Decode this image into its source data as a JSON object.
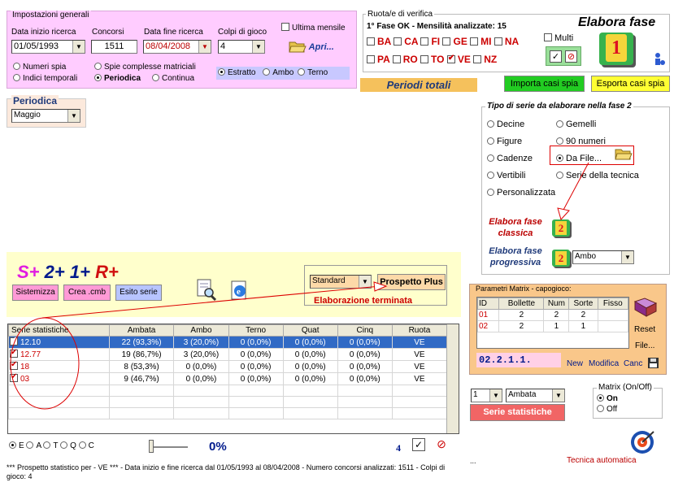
{
  "general": {
    "legend": "Impostazioni generali",
    "date_start_label": "Data inizio ricerca",
    "date_start": "01/05/1993",
    "concorsi_label": "Concorsi",
    "concorsi": "1511",
    "date_end_label": "Data fine ricerca",
    "date_end": "08/04/2008",
    "colpi_label": "Colpi di gioco",
    "colpi": "4",
    "ultima_mensile": "Ultima mensile",
    "apri": "Apri...",
    "opt_numeri_spia": "Numeri spia",
    "opt_spie_complesse": "Spie complesse matriciali",
    "opt_indici_temporali": "Indici temporali",
    "opt_periodica": "Periodica",
    "opt_continua": "Continua",
    "opt_estratto": "Estratto",
    "opt_ambo": "Ambo",
    "opt_terno": "Terno"
  },
  "periodica": {
    "legend": "Periodica",
    "value": "Maggio"
  },
  "ruote": {
    "legend": "Ruota/e di verifica",
    "status": "1° Fase OK - Mensilità analizzate: 15",
    "row1": [
      "BA",
      "CA",
      "FI",
      "GE",
      "MI",
      "NA"
    ],
    "row2": [
      "PA",
      "RO",
      "TO",
      "VE",
      "NZ"
    ],
    "multi": "Multi"
  },
  "elabora_fase": {
    "title": "Elabora fase",
    "number": "1"
  },
  "periodi_totali": "Periodi totali",
  "importa": "Importa casi spia",
  "esporta": "Esporta casi spia",
  "tipo_serie": {
    "legend": "Tipo di serie da elaborare nella fase 2",
    "left": [
      "Decine",
      "Figure",
      "Cadenze",
      "Vertibili",
      "Personalizzata"
    ],
    "right": [
      "Gemelli",
      "90 numeri",
      "Da File...",
      "Serie della tecnica"
    ]
  },
  "elabora_classica": "Elabora fase classica",
  "elabora_progressiva": "Elabora fase progressiva",
  "fase2_number": "2",
  "progressiva_select": "Ambo",
  "splus": {
    "s": "S+",
    "two": "2+",
    "one": "1+",
    "r": "R+"
  },
  "btn_sistemizza": "Sistemizza",
  "btn_crea": "Crea .cmb",
  "btn_esito": "Esito serie",
  "standard_select": "Standard",
  "prospetto_plus": "Prospetto Plus",
  "elaborazione": "Elaborazione terminata",
  "stats_table": {
    "headers": [
      "Serie statistiche",
      "Ambata",
      "Ambo",
      "Terno",
      "Quat",
      "Cinq",
      "Ruota"
    ],
    "rows": [
      [
        "12.10",
        "22 (93,3%)",
        "3 (20,0%)",
        "0 (0,0%)",
        "0 (0,0%)",
        "0 (0,0%)",
        "VE"
      ],
      [
        "12.77",
        "19 (86,7%)",
        "3 (20,0%)",
        "0 (0,0%)",
        "0 (0,0%)",
        "0 (0,0%)",
        "VE"
      ],
      [
        "18",
        "8 (53,3%)",
        "0 (0,0%)",
        "0 (0,0%)",
        "0 (0,0%)",
        "0 (0,0%)",
        "VE"
      ],
      [
        "03",
        "9 (46,7%)",
        "0 (0,0%)",
        "0 (0,0%)",
        "0 (0,0%)",
        "0 (0,0%)",
        "VE"
      ]
    ]
  },
  "bottom_radios": [
    "E",
    "A",
    "T",
    "Q",
    "C"
  ],
  "percent": "0%",
  "count": "4",
  "status_line": "*** Prospetto statistico per  - VE *** - Data inizio e fine ricerca dal 01/05/1993 al 08/04/2008 - Numero concorsi analizzati: 1511 - Colpi di gioco: 4",
  "matrix": {
    "legend": "Parametri Matrix - capogioco:",
    "headers": [
      "ID",
      "Bollette",
      "Num",
      "Sorte",
      "Fisso"
    ],
    "rows": [
      [
        "01",
        "2",
        "2",
        "2",
        ""
      ],
      [
        "02",
        "2",
        "1",
        "1",
        ""
      ]
    ],
    "code": "02.2.1.1.",
    "reset": "Reset",
    "file": "File...",
    "new": "New",
    "modifica": "Modifica",
    "canc": "Canc"
  },
  "matrix_select_num": "1",
  "matrix_select_sorte": "Ambata",
  "serie_statistiche_btn": "Serie statistiche",
  "matrix_onoff": {
    "legend": "Matrix (On/Off)",
    "on": "On",
    "off": "Off"
  },
  "tecnica_automatica": "Tecnica automatica",
  "ellipsis": "..."
}
